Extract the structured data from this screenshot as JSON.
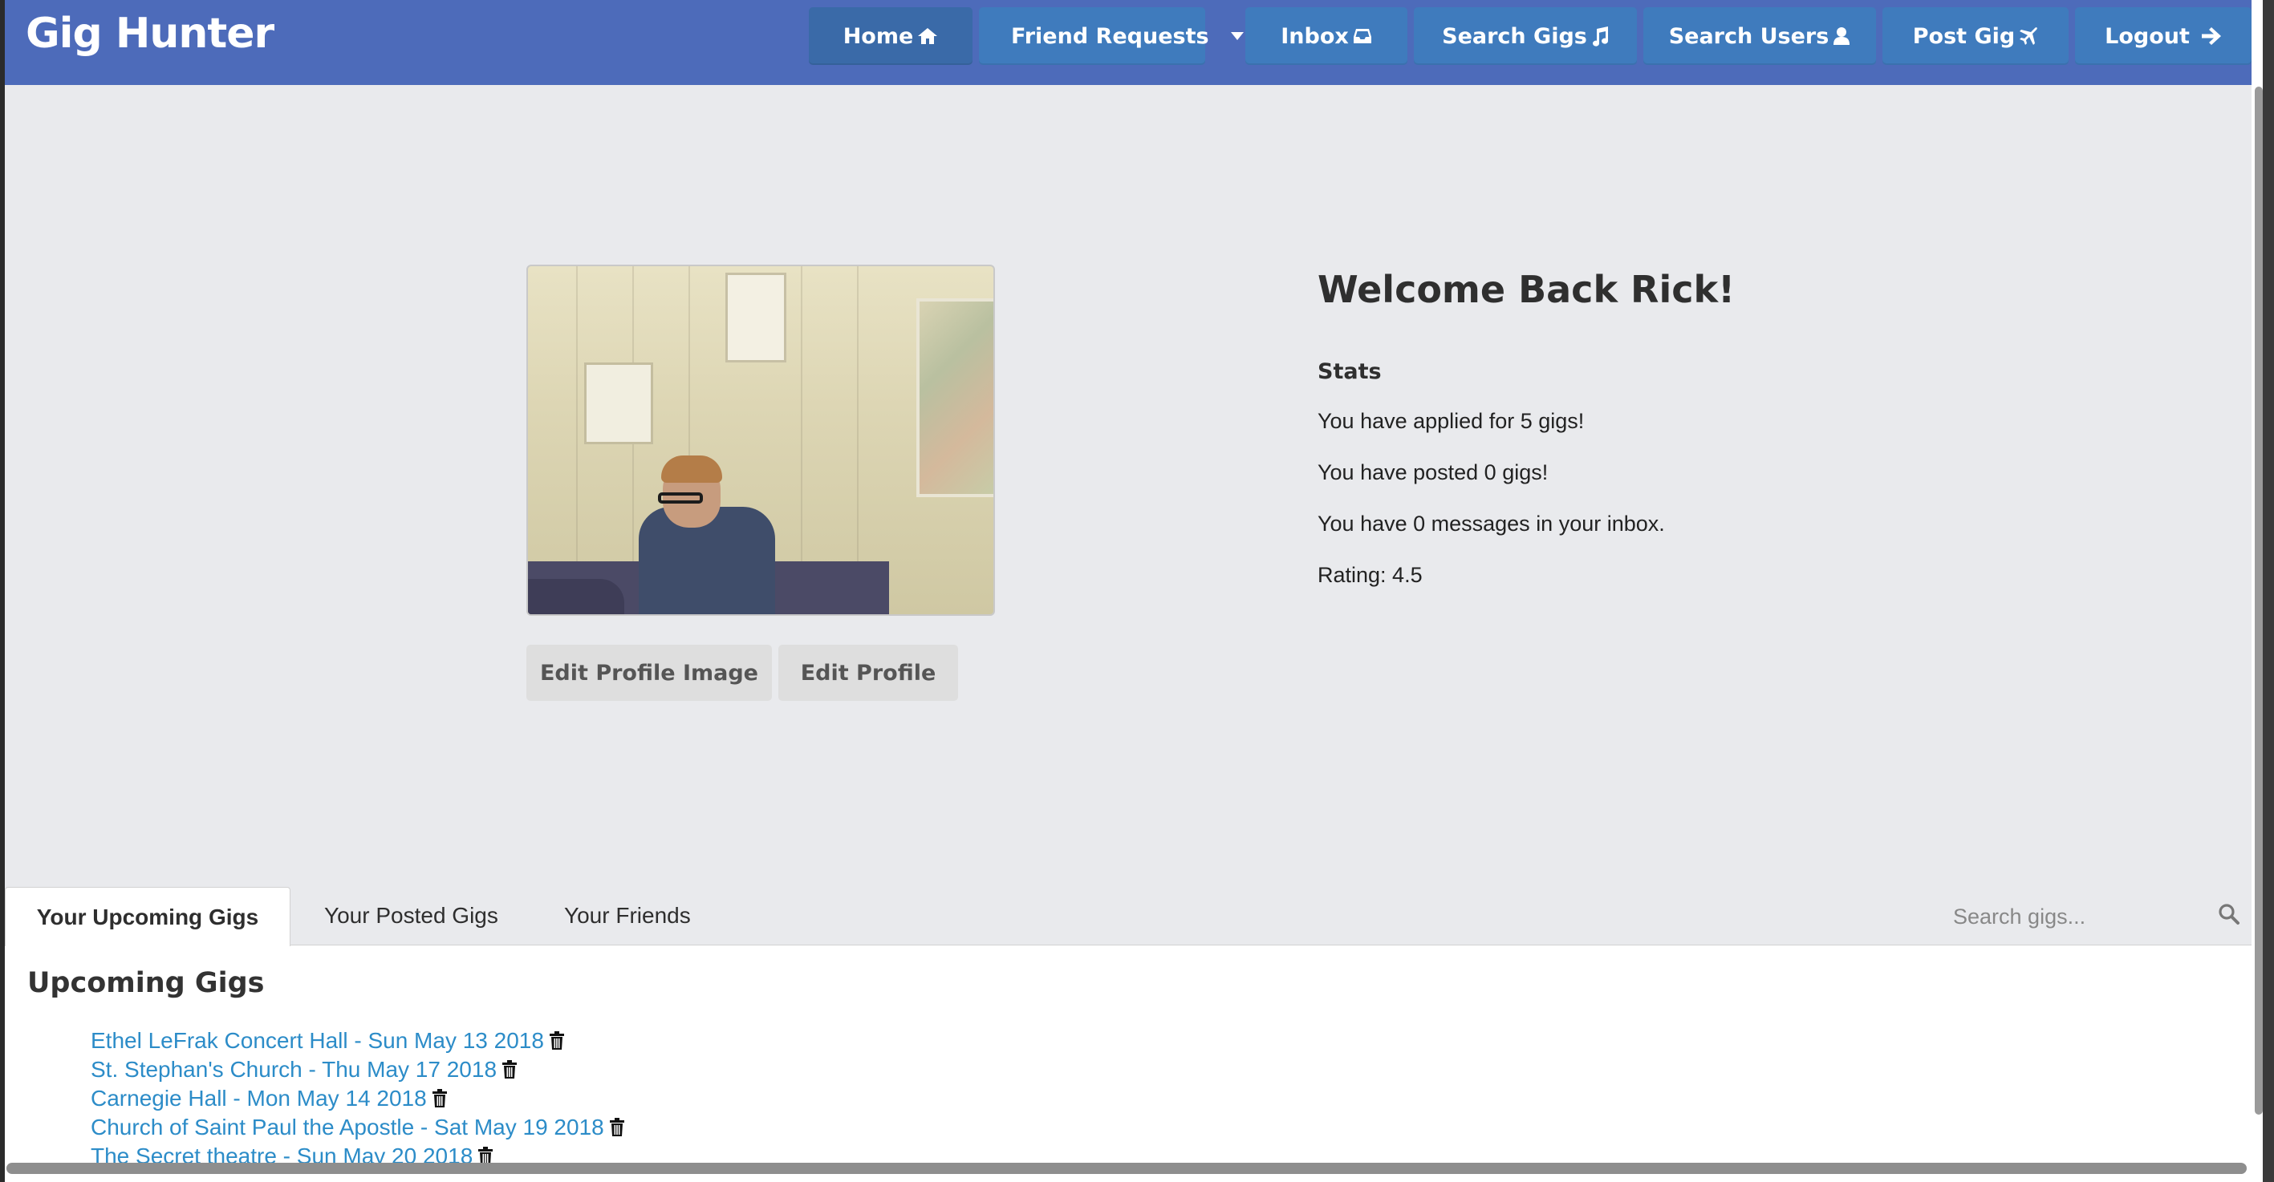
{
  "app": {
    "brand": "Gig Hunter"
  },
  "nav": {
    "home": "Home",
    "friend_requests": "Friend Requests",
    "inbox": "Inbox",
    "search_gigs": "Search Gigs",
    "search_users": "Search Users",
    "post_gig": "Post Gig",
    "logout": "Logout"
  },
  "profile": {
    "edit_image_label": "Edit Profile Image",
    "edit_profile_label": "Edit Profile"
  },
  "welcome": {
    "title": "Welcome Back Rick!",
    "stats_heading": "Stats",
    "applied": "You have applied for 5 gigs!",
    "posted": "You have posted 0 gigs!",
    "messages": "You have 0 messages in your inbox.",
    "rating": "Rating: 4.5"
  },
  "tabs": {
    "upcoming": "Your Upcoming Gigs",
    "posted": "Your Posted Gigs",
    "friends": "Your Friends",
    "search_placeholder": "Search gigs..."
  },
  "upcoming": {
    "title": "Upcoming Gigs",
    "gigs": [
      "Ethel LeFrak Concert Hall - Sun May 13 2018",
      "St. Stephan's Church - Thu May 17 2018",
      "Carnegie Hall - Mon May 14 2018",
      "Church of Saint Paul the Apostle - Sat May 19 2018",
      "The Secret theatre - Sun May 20 2018"
    ]
  },
  "colors": {
    "navbar": "#4d6bba",
    "nav_button": "#3f7bbd",
    "link": "#2c8cc8",
    "hero_bg": "#e9eaed"
  }
}
